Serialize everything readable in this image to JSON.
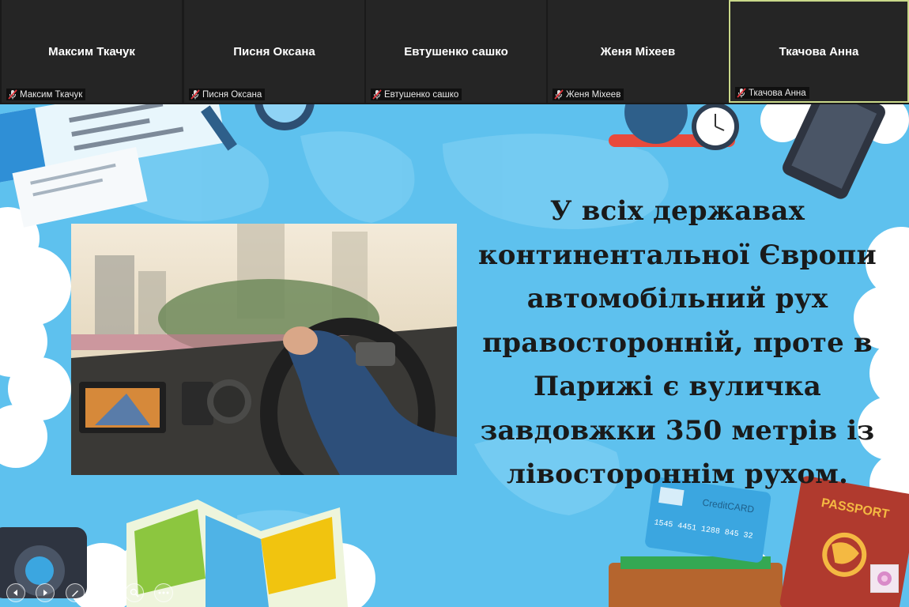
{
  "participants": [
    {
      "display_name": "Максим Ткачук",
      "label": "Максим Ткачук",
      "muted": true,
      "active": false
    },
    {
      "display_name": "Писня Оксана",
      "label": "Писня Оксана",
      "muted": true,
      "active": false
    },
    {
      "display_name": "Евтушенко сашко",
      "label": "Евтушенко сашко",
      "muted": true,
      "active": false
    },
    {
      "display_name": "Женя Міхеев",
      "label": "Женя Міхеев",
      "muted": true,
      "active": false
    },
    {
      "display_name": "Ткачова Анна",
      "label": "Ткачова Анна",
      "muted": true,
      "active": true
    }
  ],
  "slide": {
    "lines": [
      "У всіх державах",
      "континентальної Європи",
      "автомобільний рух",
      "правосторонній, проте в",
      "Парижі є вуличка",
      "завдовжки 350 метрів із",
      "лівостороннім рухом."
    ],
    "card_text": "CreditCARD",
    "card_number": "1545 4451 1288 845 32",
    "passport_text": "PASSPORT"
  },
  "presentation_controls": [
    "previous-icon",
    "next-icon",
    "pen-icon",
    "slides-icon",
    "zoom-icon",
    "more-icon"
  ],
  "colors": {
    "slide_bg": "#5ec1ee",
    "strip_bg": "#1a1a1a",
    "tile_bg": "#252525",
    "active_border": "#c9d88a",
    "muted_icon": "#e2343b"
  }
}
